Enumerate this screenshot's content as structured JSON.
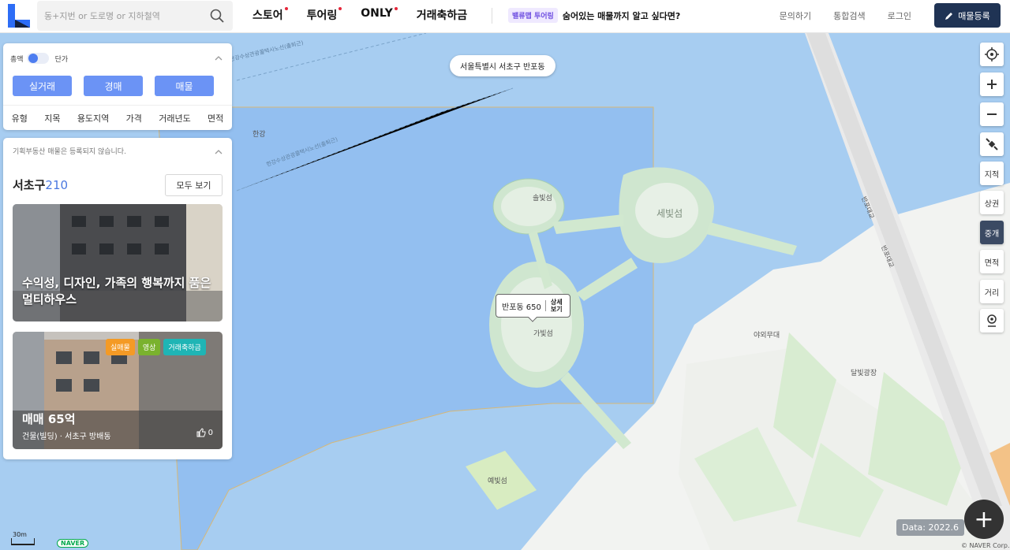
{
  "header": {
    "search_placeholder": "동+지번 or 도로명 or 지하철역",
    "nav": [
      {
        "label": "스토어",
        "new": true
      },
      {
        "label": "투어링",
        "new": true
      },
      {
        "label": "ONLY",
        "new": true
      },
      {
        "label": "거래축하금",
        "new": false
      }
    ],
    "promo_badge": "밸류맵 투어링",
    "promo_text": "숨어있는 매물까지 알고 싶다면?",
    "links": [
      "문의하기",
      "통합검색",
      "로그인"
    ],
    "register_label": "매물등록"
  },
  "filter_panel": {
    "toggle_left": "총액",
    "toggle_right": "단가",
    "tabs": [
      "실거래",
      "경매",
      "매물"
    ],
    "filters": [
      "유형",
      "지목",
      "용도지역",
      "가격",
      "거래년도",
      "면적"
    ]
  },
  "listing_panel": {
    "notice": "기획부동산 매물은 등록되지 않습니다.",
    "district": "서초구",
    "count": "210",
    "view_all": "모두 보기",
    "card1": {
      "title_line1": "수익성, 디자인, 가족의 행복까지 품은",
      "title_line2": "멀티하우스"
    },
    "card2": {
      "tags": [
        "실매물",
        "영상",
        "거래축하금"
      ],
      "price": "매매 65억",
      "sub": "건물(빌딩) · 서초구 방배동",
      "likes": "0"
    }
  },
  "map": {
    "location_pill": "서울특별시 서초구 반포동",
    "popup_label": "반포동 650",
    "popup_detail_1": "상세",
    "popup_detail_2": "보기",
    "labels": {
      "hangang": "한강",
      "solbit": "솔빛섬",
      "sebit": "세빛섬",
      "gabit": "가빛섬",
      "yebit": "예빛섬",
      "outdoor_stage": "야외무대",
      "moonlight_plaza": "달빛광장",
      "road1": "반포대교",
      "road2": "반포대교",
      "ferry1": "한강수상관광콜택시노선(출퇴근)",
      "ferry2": "한강수상관광콜택시노선(출퇴근)"
    },
    "side_buttons": [
      "지적",
      "상권",
      "중개",
      "면적",
      "거리"
    ],
    "active_side": "중개",
    "data_stamp": "Data: 2022.6",
    "scale": "30m",
    "naver": "NAVER",
    "copyright": "© NAVER Corp."
  },
  "colors": {
    "accent": "#6b93f5",
    "brand_dark": "#1f3354",
    "water": "#a9cdf0",
    "new_dot": "#e6263a"
  }
}
